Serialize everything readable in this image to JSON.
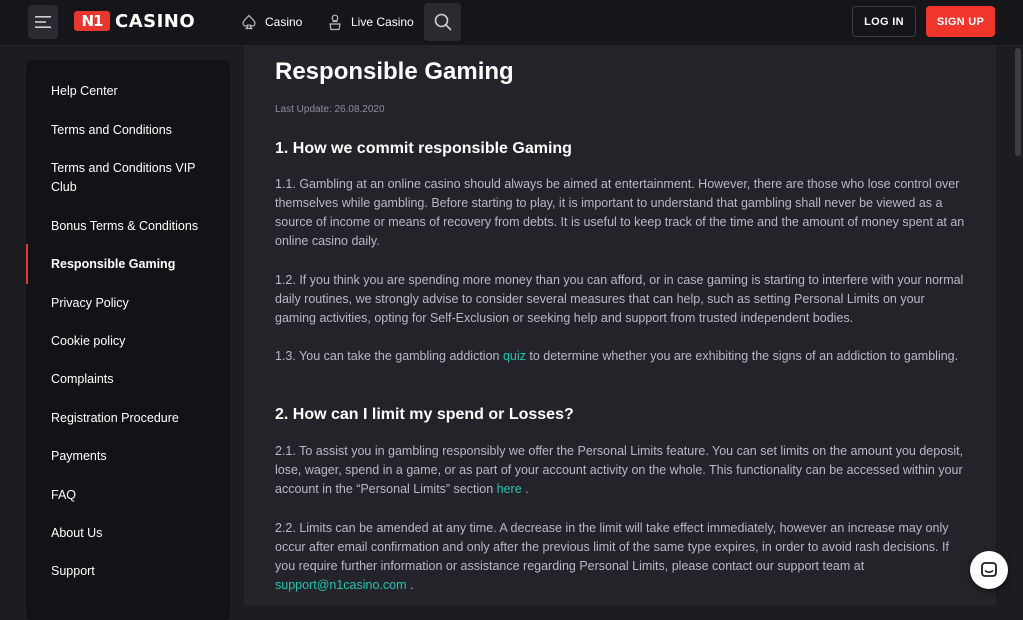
{
  "header": {
    "logo_badge": "N1",
    "logo_text": "CASINO",
    "nav": [
      {
        "label": "Casino",
        "icon": "spade-icon"
      },
      {
        "label": "Live Casino",
        "icon": "dealer-icon"
      }
    ],
    "login_label": "LOG IN",
    "signup_label": "SIGN UP"
  },
  "sidebar": {
    "items": [
      {
        "label": "Help Center"
      },
      {
        "label": "Terms and Conditions"
      },
      {
        "label": "Terms and Conditions VIP Club"
      },
      {
        "label": "Bonus Terms & Conditions"
      },
      {
        "label": "Responsible Gaming",
        "active": true
      },
      {
        "label": "Privacy Policy"
      },
      {
        "label": "Cookie policy"
      },
      {
        "label": "Complaints"
      },
      {
        "label": "Registration Procedure"
      },
      {
        "label": "Payments"
      },
      {
        "label": "FAQ"
      },
      {
        "label": "About Us"
      },
      {
        "label": "Support"
      }
    ]
  },
  "content": {
    "title": "Responsible Gaming",
    "last_update": "Last Update: 26.08.2020",
    "section1_heading": "1. How we commit responsible Gaming",
    "p1_1": "1.1. Gambling at an online casino should always be aimed at entertainment. However, there are those who lose control over themselves while gambling. Before starting to play, it is important to understand that gambling shall never be viewed as a source of income or means of recovery from debts. It is useful to keep track of the time and the amount of money spent at an online casino daily.",
    "p1_2": "1.2. If you think you are spending more money than you can afford, or in case gaming is starting to interfere with your normal daily routines, we strongly advise to consider several measures that can help, such as setting Personal Limits on your gaming activities, opting for Self-Exclusion or seeking help and support from trusted independent bodies.",
    "p1_3_before": "1.3. You can take the gambling addiction ",
    "p1_3_link": "quiz",
    "p1_3_after": " to determine whether you are exhibiting the signs of an addiction to gambling.",
    "section2_heading": "2. How can I limit my spend or Losses?",
    "p2_1_before": "2.1. To assist you in gambling responsibly we offer the Personal Limits feature. You can set limits on the amount you deposit, lose, wager, spend in a game, or as part of your account activity on the whole. This functionality can be accessed within your account in the “Personal Limits” section ",
    "p2_1_link": "here",
    "p2_1_after": " .",
    "p2_2_before": "2.2. Limits can be amended at any time. A decrease in the limit will take effect immediately, however an increase may only occur after email confirmation and only after the previous limit of the same type expires, in order to avoid rash decisions. If you require further information or assistance regarding Personal Limits, please contact our support team at ",
    "p2_2_link": "support@n1casino.com",
    "p2_2_after": " ."
  },
  "colors": {
    "accent_red": "#f0362a",
    "link_teal": "#23c5b0",
    "bg": "#1c1c21",
    "panel": "#232329",
    "sidebar": "#131317"
  }
}
